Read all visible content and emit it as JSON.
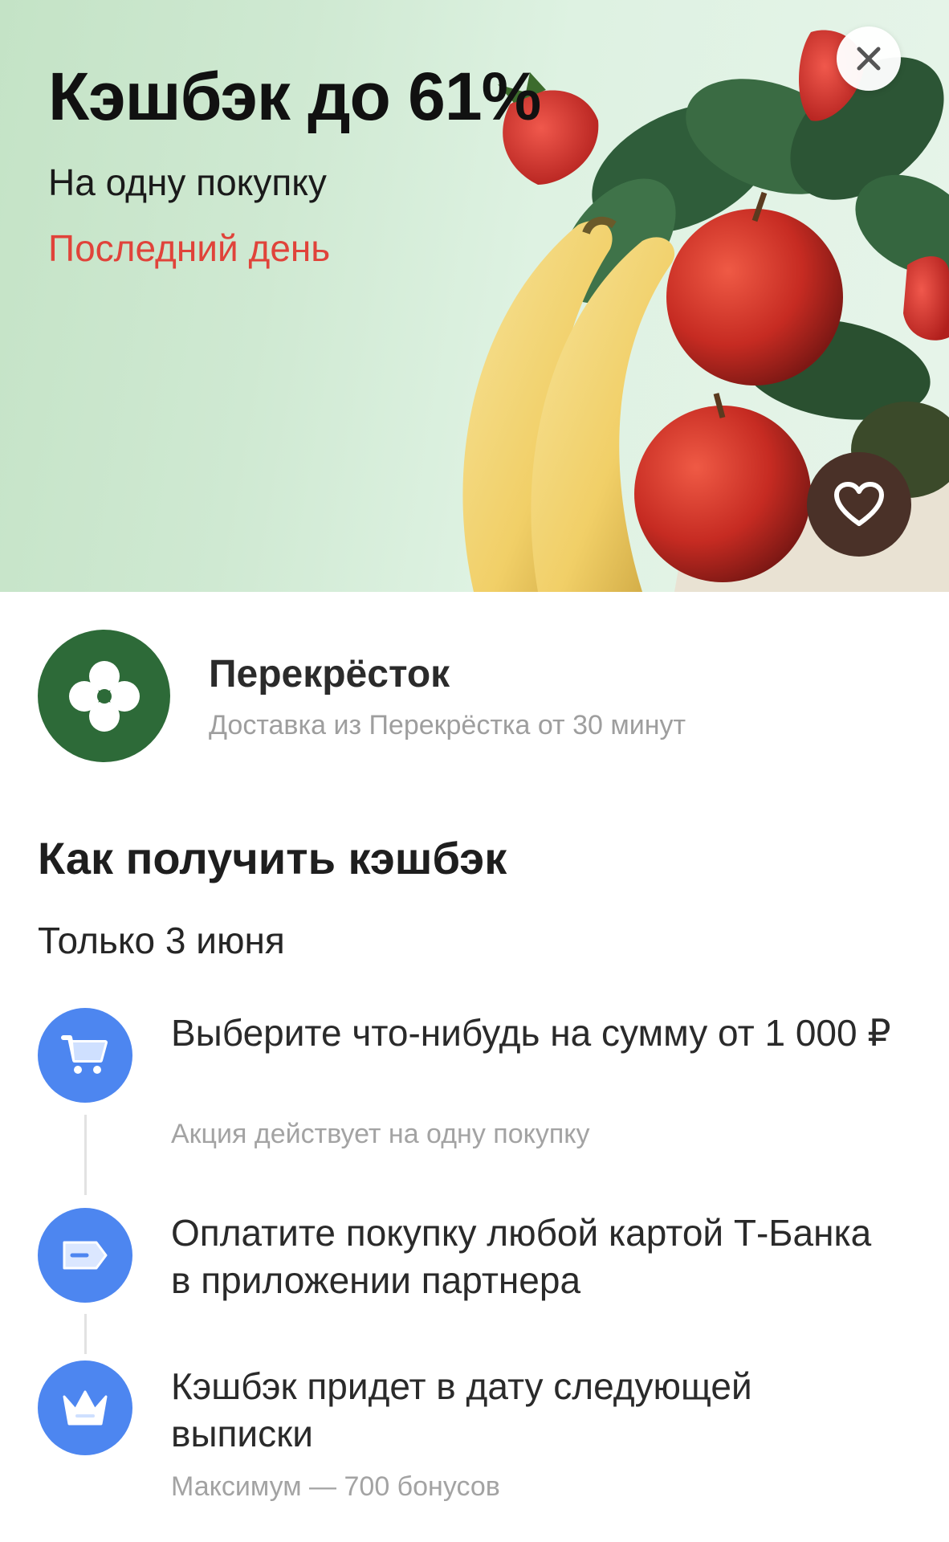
{
  "hero": {
    "title": "Кэшбэк до 61%",
    "subtitle": "На одну покупку",
    "deadline": "Последний день",
    "deadline_color": "#e0433a",
    "background_color": "#cfe9d2",
    "illustration": "fruits-vegetables-bag",
    "close_icon": "close-icon",
    "favorite_icon": "heart-icon"
  },
  "merchant": {
    "name": "Перекрёсток",
    "description": "Доставка из Перекрёстка от 30 минут",
    "logo_color": "#2d6a38"
  },
  "how_to": {
    "title": "Как получить кэшбэк",
    "date_note": "Только 3 июня",
    "steps": [
      {
        "icon": "cart-icon",
        "title": "Выберите что-нибудь на сумму от 1 000 ₽",
        "note": "Акция действует на одну покупку"
      },
      {
        "icon": "card-icon",
        "title": "Оплатите покупку любой картой Т-Банка в приложении партнера",
        "note": ""
      },
      {
        "icon": "crown-icon",
        "title": "Кэшбэк придет в дату следующей выписки",
        "note": "Максимум — 700 бонусов"
      }
    ],
    "icon_color": "#4d86f0"
  }
}
